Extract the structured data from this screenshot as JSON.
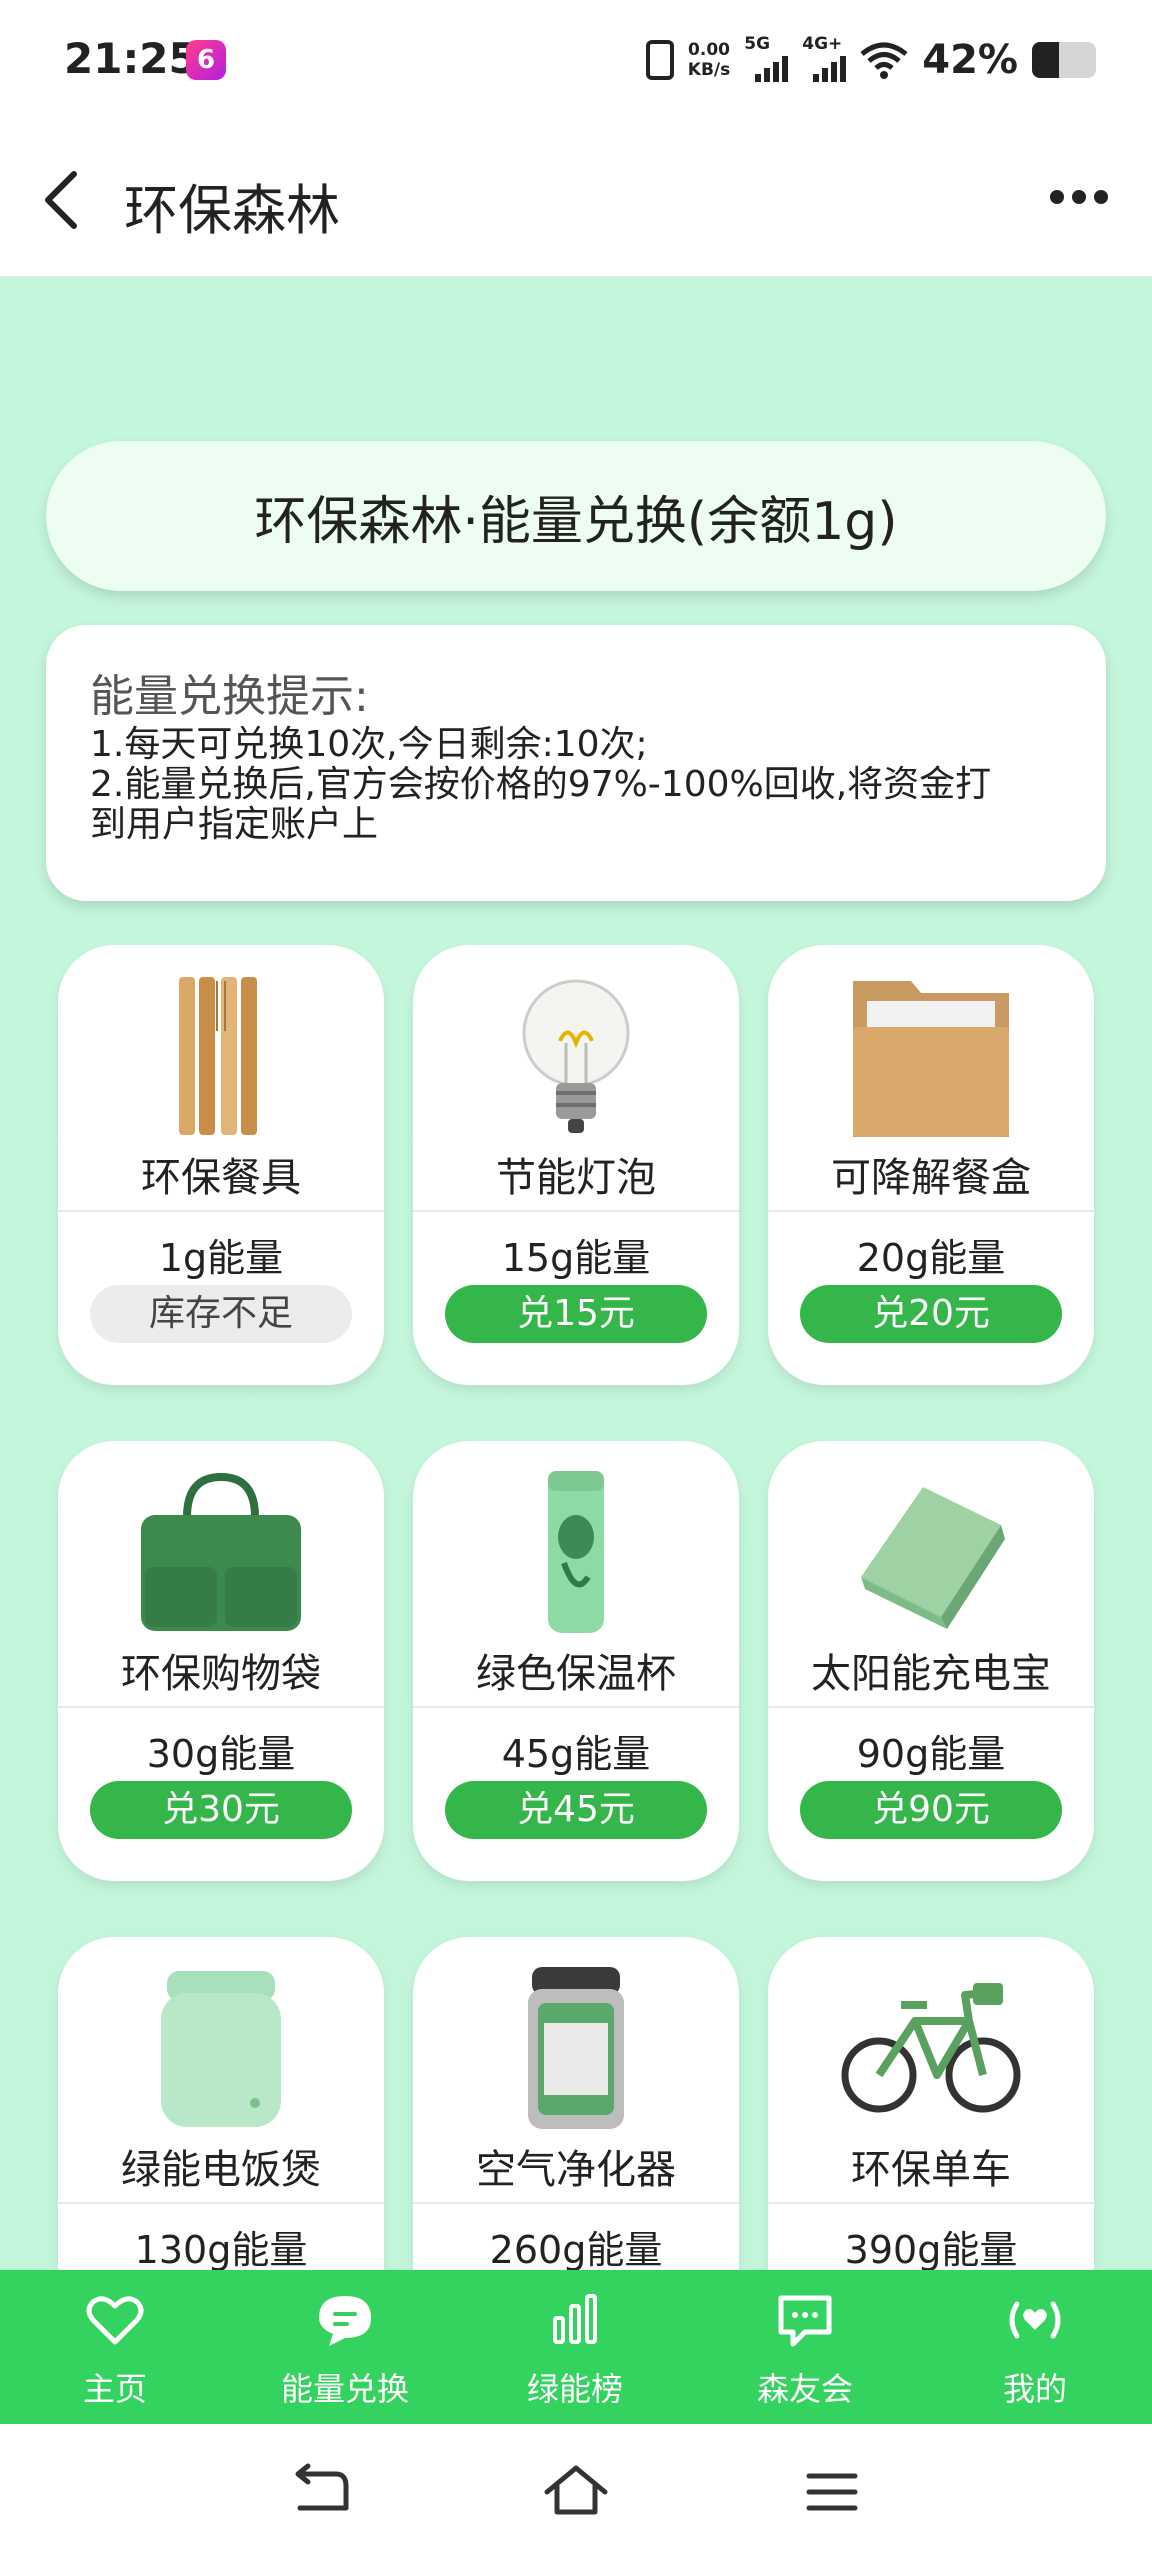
{
  "status_bar": {
    "time": "21:25",
    "app_badge": "6",
    "net_speed_value": "0.00",
    "net_speed_unit": "KB/s",
    "sim1_label": "5G",
    "sim2_label": "4G+",
    "battery_pct": "42%",
    "battery_level": 0.42
  },
  "header": {
    "title": "环保森林",
    "back_icon": "chevron-left-icon",
    "more_icon": "more-horizontal-icon"
  },
  "banner": {
    "title": "环保森林·能量兑换(余额1g)"
  },
  "tips": {
    "title": "能量兑换提示:",
    "line1": "1.每天可兑换10次,今日剩余:10次;",
    "line2a": "2.能量兑换后,官方会按价格的97%-100%回收,将资金打",
    "line2b": "到用户指定账户上"
  },
  "products": [
    {
      "name": "环保餐具",
      "energy": "1g能量",
      "button": "库存不足",
      "available": false,
      "icon": "cutlery-icon"
    },
    {
      "name": "节能灯泡",
      "energy": "15g能量",
      "button": "兑15元",
      "available": true,
      "icon": "light-bulb-icon"
    },
    {
      "name": "可降解餐盒",
      "energy": "20g能量",
      "button": "兑20元",
      "available": true,
      "icon": "food-box-icon"
    },
    {
      "name": "环保购物袋",
      "energy": "30g能量",
      "button": "兑30元",
      "available": true,
      "icon": "shopping-bag-icon"
    },
    {
      "name": "绿色保温杯",
      "energy": "45g能量",
      "button": "兑45元",
      "available": true,
      "icon": "thermos-icon"
    },
    {
      "name": "太阳能充电宝",
      "energy": "90g能量",
      "button": "兑90元",
      "available": true,
      "icon": "power-bank-icon"
    },
    {
      "name": "绿能电饭煲",
      "energy": "130g能量",
      "button": "",
      "available": true,
      "icon": "rice-cooker-icon"
    },
    {
      "name": "空气净化器",
      "energy": "260g能量",
      "button": "",
      "available": true,
      "icon": "air-purifier-icon"
    },
    {
      "name": "环保单车",
      "energy": "390g能量",
      "button": "",
      "available": true,
      "icon": "bicycle-icon"
    }
  ],
  "tabbar": {
    "items": [
      {
        "label": "主页",
        "icon": "heart-icon"
      },
      {
        "label": "能量兑换",
        "icon": "chat-bubble-icon",
        "active": true
      },
      {
        "label": "绿能榜",
        "icon": "bar-chart-icon"
      },
      {
        "label": "森友会",
        "icon": "message-square-icon"
      },
      {
        "label": "我的",
        "icon": "broadcast-heart-icon"
      }
    ]
  },
  "system_nav": {
    "back_icon": "back-arrow-icon",
    "home_icon": "home-icon",
    "menu_icon": "menu-icon"
  },
  "colors": {
    "accent": "#35b64a",
    "tabbar": "#34d25f",
    "background": "#c4f6dc"
  }
}
